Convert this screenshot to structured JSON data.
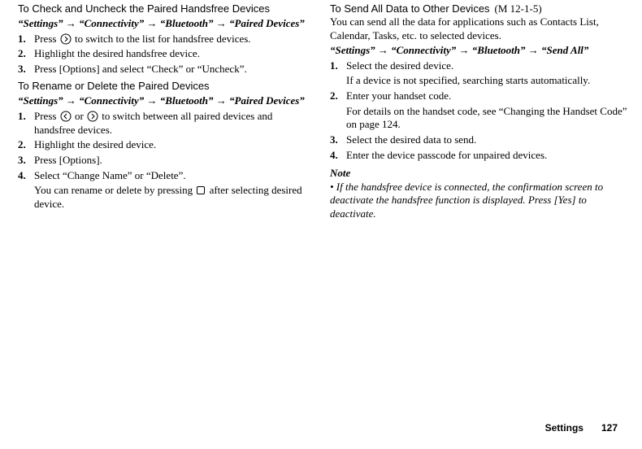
{
  "left": {
    "sec1": {
      "title": "To Check and Uncheck the Paired Handsfree Devices",
      "path": "“Settings” → “Connectivity” → “Bluetooth” → “Paired Devices”",
      "steps": [
        {
          "num": "1.",
          "before": "Press ",
          "icon": "right",
          "after": " to switch to the list for handsfree devices."
        },
        {
          "num": "2.",
          "text": "Highlight the desired handsfree device."
        },
        {
          "num": "3.",
          "text": "Press [Options] and select “Check” or “Uncheck”."
        }
      ]
    },
    "sec2": {
      "title": "To Rename or Delete the Paired Devices",
      "path": "“Settings” → “Connectivity” → “Bluetooth” → “Paired Devices”",
      "steps": [
        {
          "num": "1.",
          "before": "Press ",
          "icon": "left",
          "mid": " or ",
          "icon2": "right",
          "after": " to switch between all paired devices and handsfree devices."
        },
        {
          "num": "2.",
          "text": "Highlight the desired device."
        },
        {
          "num": "3.",
          "text": "Press [Options]."
        },
        {
          "num": "4.",
          "text": "Select “Change Name” or “Delete”.",
          "extraBefore": "You can rename or delete by pressing ",
          "extraIcon": "center",
          "extraAfter": " after selecting desired device."
        }
      ]
    }
  },
  "right": {
    "sec1": {
      "title": "To Send All Data to Other Devices",
      "ref": "(M 12-1-5)",
      "intro": "You can send all the data for applications such as Contacts List, Calendar, Tasks, etc. to selected devices.",
      "path": "“Settings” → “Connectivity” → “Bluetooth” → “Send All”",
      "steps": [
        {
          "num": "1.",
          "text": "Select the desired device.",
          "extra": "If a device is not specified, searching starts automatically."
        },
        {
          "num": "2.",
          "text": "Enter your handset code.",
          "extra": "For details on the handset code, see “Changing the Handset Code” on page 124."
        },
        {
          "num": "3.",
          "text": "Select the desired data to send."
        },
        {
          "num": "4.",
          "text": "Enter the device passcode for unpaired devices."
        }
      ],
      "noteLabel": "Note",
      "noteText": "• If the handsfree device is connected, the confirmation screen to deactivate the handsfree function is displayed. Press [Yes] to deactivate."
    }
  },
  "footer": {
    "label": "Settings",
    "page": "127"
  }
}
